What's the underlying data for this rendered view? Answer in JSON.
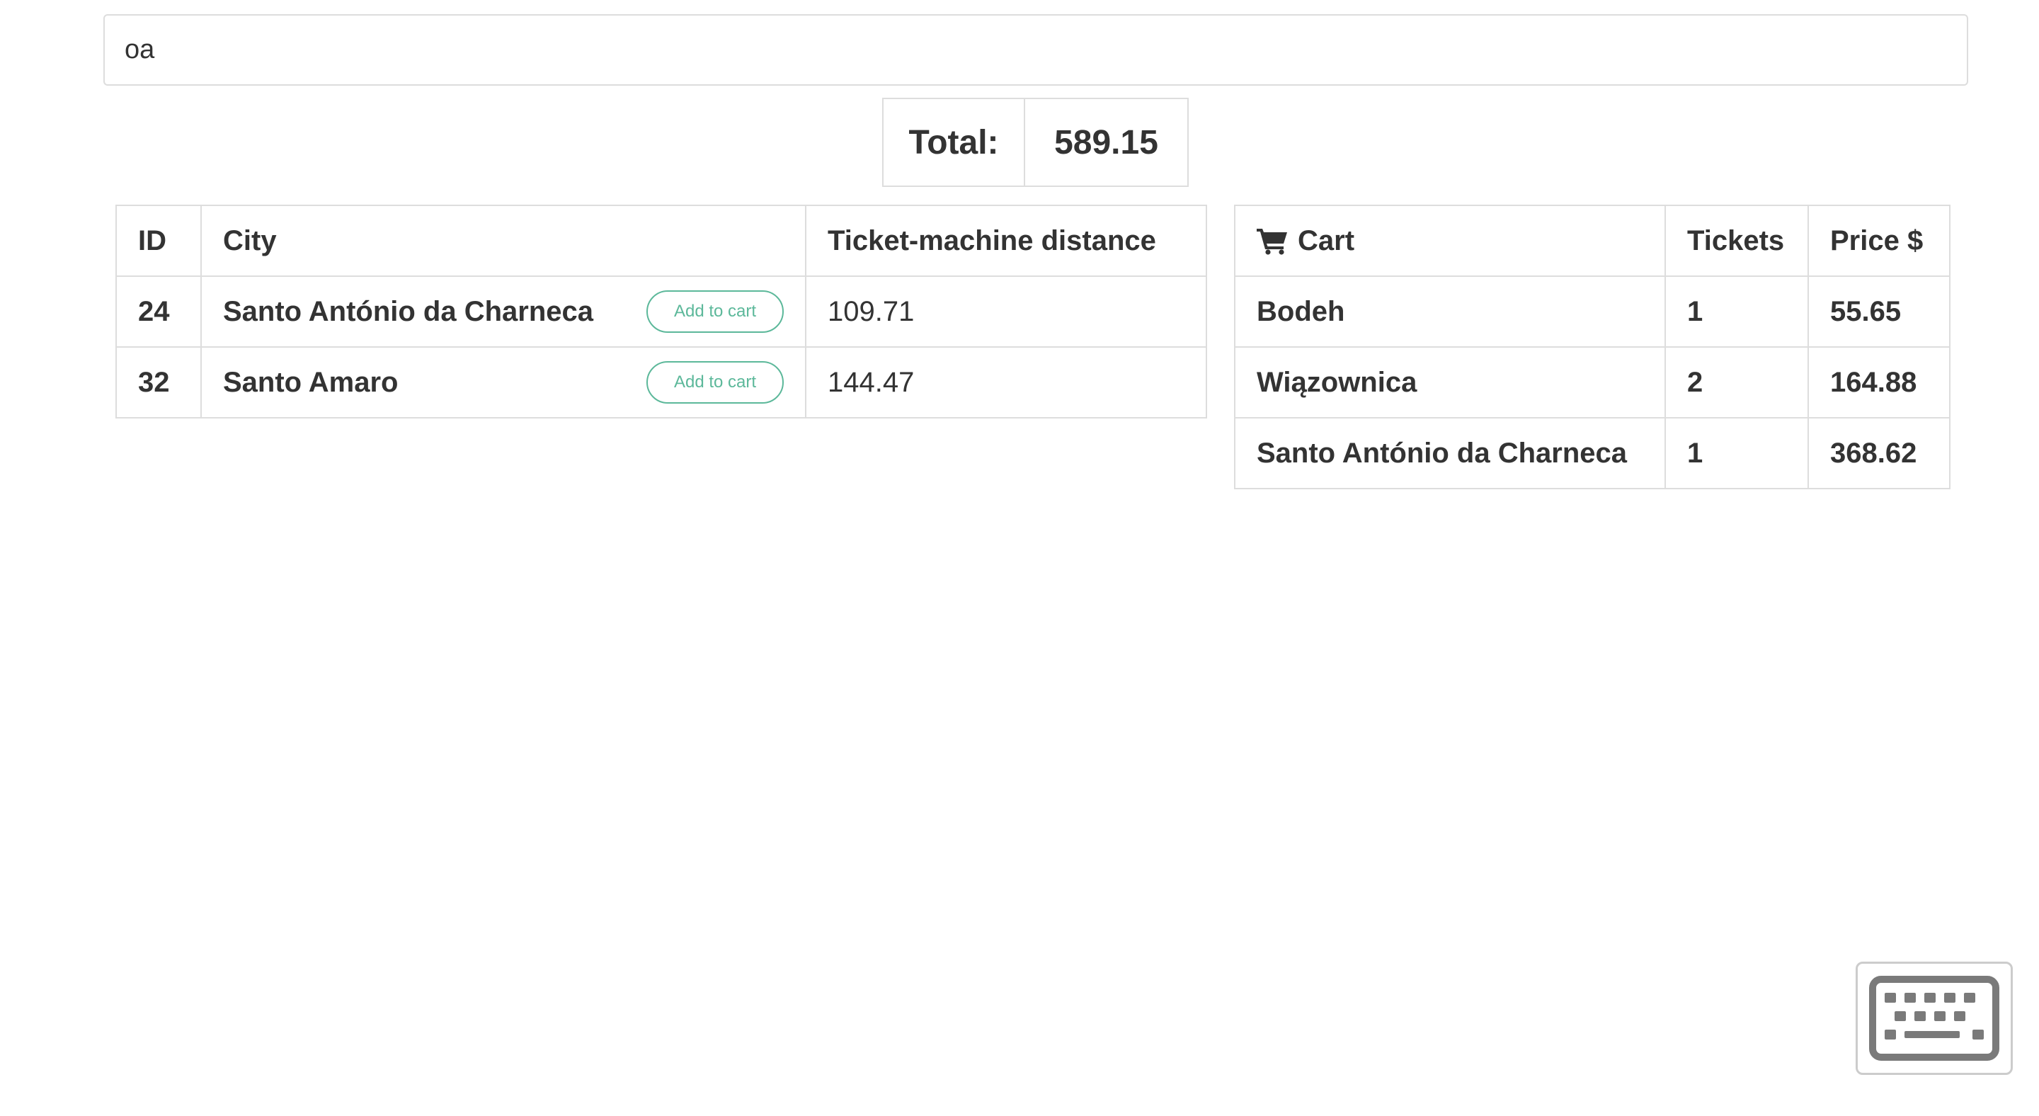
{
  "search": {
    "value": "oa"
  },
  "total": {
    "label": "Total:",
    "value": "589.15"
  },
  "cities_table": {
    "headers": [
      "ID",
      "City",
      "Ticket-machine distance"
    ],
    "rows": [
      {
        "id": "24",
        "city": "Santo António da Charneca",
        "button": "Add to cart",
        "distance": "109.71"
      },
      {
        "id": "32",
        "city": "Santo Amaro",
        "button": "Add to cart",
        "distance": "144.47"
      }
    ]
  },
  "cart_table": {
    "icon": "shopping-cart-icon",
    "headers": [
      "Cart",
      "Tickets",
      "Price $"
    ],
    "rows": [
      {
        "city": "Bodeh",
        "tickets": "1",
        "price": "55.65"
      },
      {
        "city": "Wiązownica",
        "tickets": "2",
        "price": "164.88"
      },
      {
        "city": "Santo António da Charneca",
        "tickets": "1",
        "price": "368.62"
      }
    ]
  },
  "keyboard": {
    "icon": "keyboard-icon"
  },
  "colors": {
    "accent": "#5cb89a",
    "border": "#dddddd",
    "text": "#333333"
  }
}
